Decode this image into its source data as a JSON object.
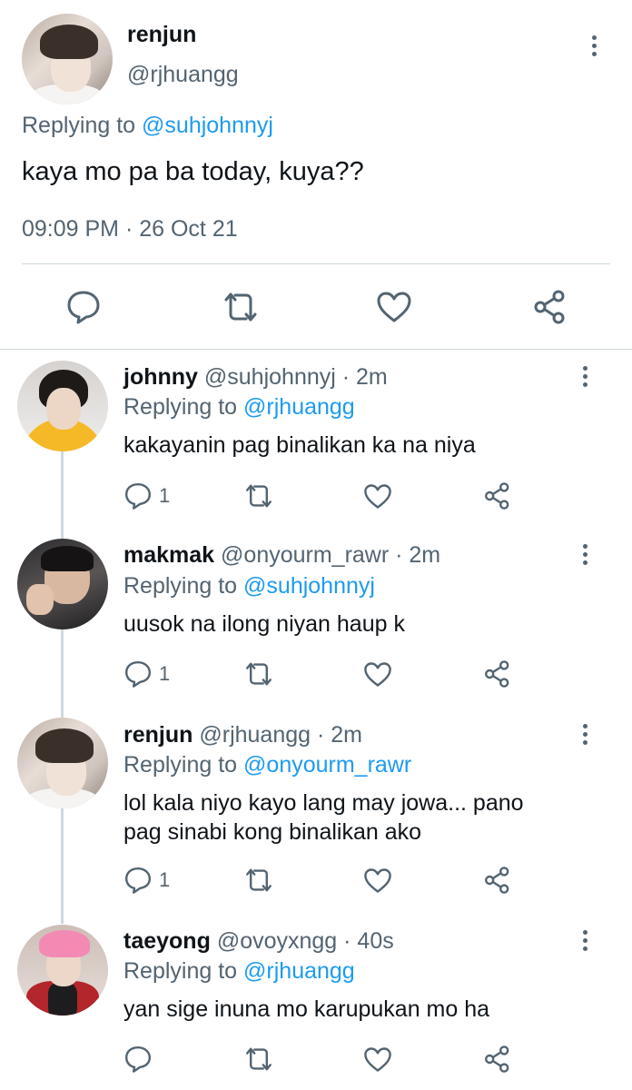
{
  "main_tweet": {
    "name": "renjun",
    "handle": "@rjhuangg",
    "replying_prefix": "Replying to",
    "replying_to": "@suhjohnnyj",
    "text": "kaya mo pa ba today, kuya??",
    "timestamp": "09:09 PM · 26 Oct 21",
    "actions": [
      "reply-icon",
      "retweet-icon",
      "like-icon",
      "share-icon"
    ]
  },
  "replies": [
    {
      "name": "johnny",
      "meta": "@suhjohnnyj · 2m",
      "replying_prefix": "Replying to",
      "replying_to": "@rjhuangg",
      "text": "kakayanin pag binalikan ka na niya",
      "reply_count": "1"
    },
    {
      "name": "makmak",
      "meta": "@onyourm_rawr · 2m",
      "replying_prefix": "Replying to",
      "replying_to": "@suhjohnnyj",
      "text": "uusok na ilong niyan haup k",
      "reply_count": "1"
    },
    {
      "name": "renjun",
      "meta": "@rjhuangg · 2m",
      "replying_prefix": "Replying to",
      "replying_to": "@onyourm_rawr",
      "text": "lol kala niyo kayo lang may jowa... pano pag sinabi kong binalikan ako",
      "reply_count": "1"
    },
    {
      "name": "taeyong",
      "meta": "@ovoyxngg · 40s",
      "replying_prefix": "Replying to",
      "replying_to": "@rjhuangg",
      "text": "yan sige inuna mo karupukan mo ha",
      "reply_count": ""
    }
  ],
  "colors": {
    "accent": "#1d9bf0",
    "secondary_text": "#536471",
    "primary_text": "#0f1419",
    "divider": "#cfd9de"
  }
}
